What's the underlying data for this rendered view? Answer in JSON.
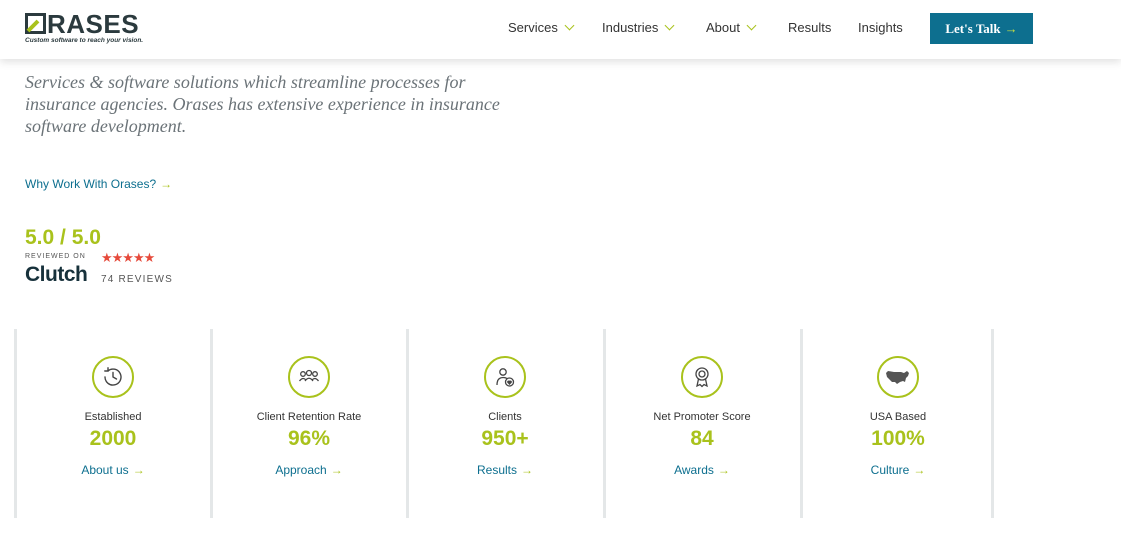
{
  "header": {
    "logo_text": "RASES",
    "logo_tagline": "Custom software to reach your vision.",
    "nav": [
      {
        "label": "Services",
        "dropdown": true
      },
      {
        "label": "Industries",
        "dropdown": true
      },
      {
        "label": "About",
        "dropdown": true
      },
      {
        "label": "Results",
        "dropdown": false
      },
      {
        "label": "Insights",
        "dropdown": false
      }
    ],
    "cta_label": "Let's Talk",
    "arrow": "→"
  },
  "intro": "Services & software solutions which streamline processes for insurance agencies. Orases has extensive experience in insurance software development.",
  "why_link": "Why Work With Orases?",
  "clutch": {
    "score": "5.0 / 5.0",
    "reviewed_on": "REVIEWED ON",
    "stars": "★★★★★",
    "brand": "Clutch",
    "reviews": "74 REVIEWS",
    "rating": 5
  },
  "stats": [
    {
      "icon": "history-clock-icon",
      "label": "Established",
      "value": "2000",
      "link": "About us"
    },
    {
      "icon": "group-people-icon",
      "label": "Client Retention Rate",
      "value": "96%",
      "link": "Approach"
    },
    {
      "icon": "client-heart-icon",
      "label": "Clients",
      "value": "950+",
      "link": "Results"
    },
    {
      "icon": "award-ribbon-icon",
      "label": "Net Promoter Score",
      "value": "84",
      "link": "Awards"
    },
    {
      "icon": "usa-map-icon",
      "label": "USA Based",
      "value": "100%",
      "link": "Culture"
    }
  ],
  "colors": {
    "accent": "#a9c21c",
    "brand": "#0d6f8f",
    "dark": "#2b3a3e",
    "stars": "#e64a3b"
  }
}
